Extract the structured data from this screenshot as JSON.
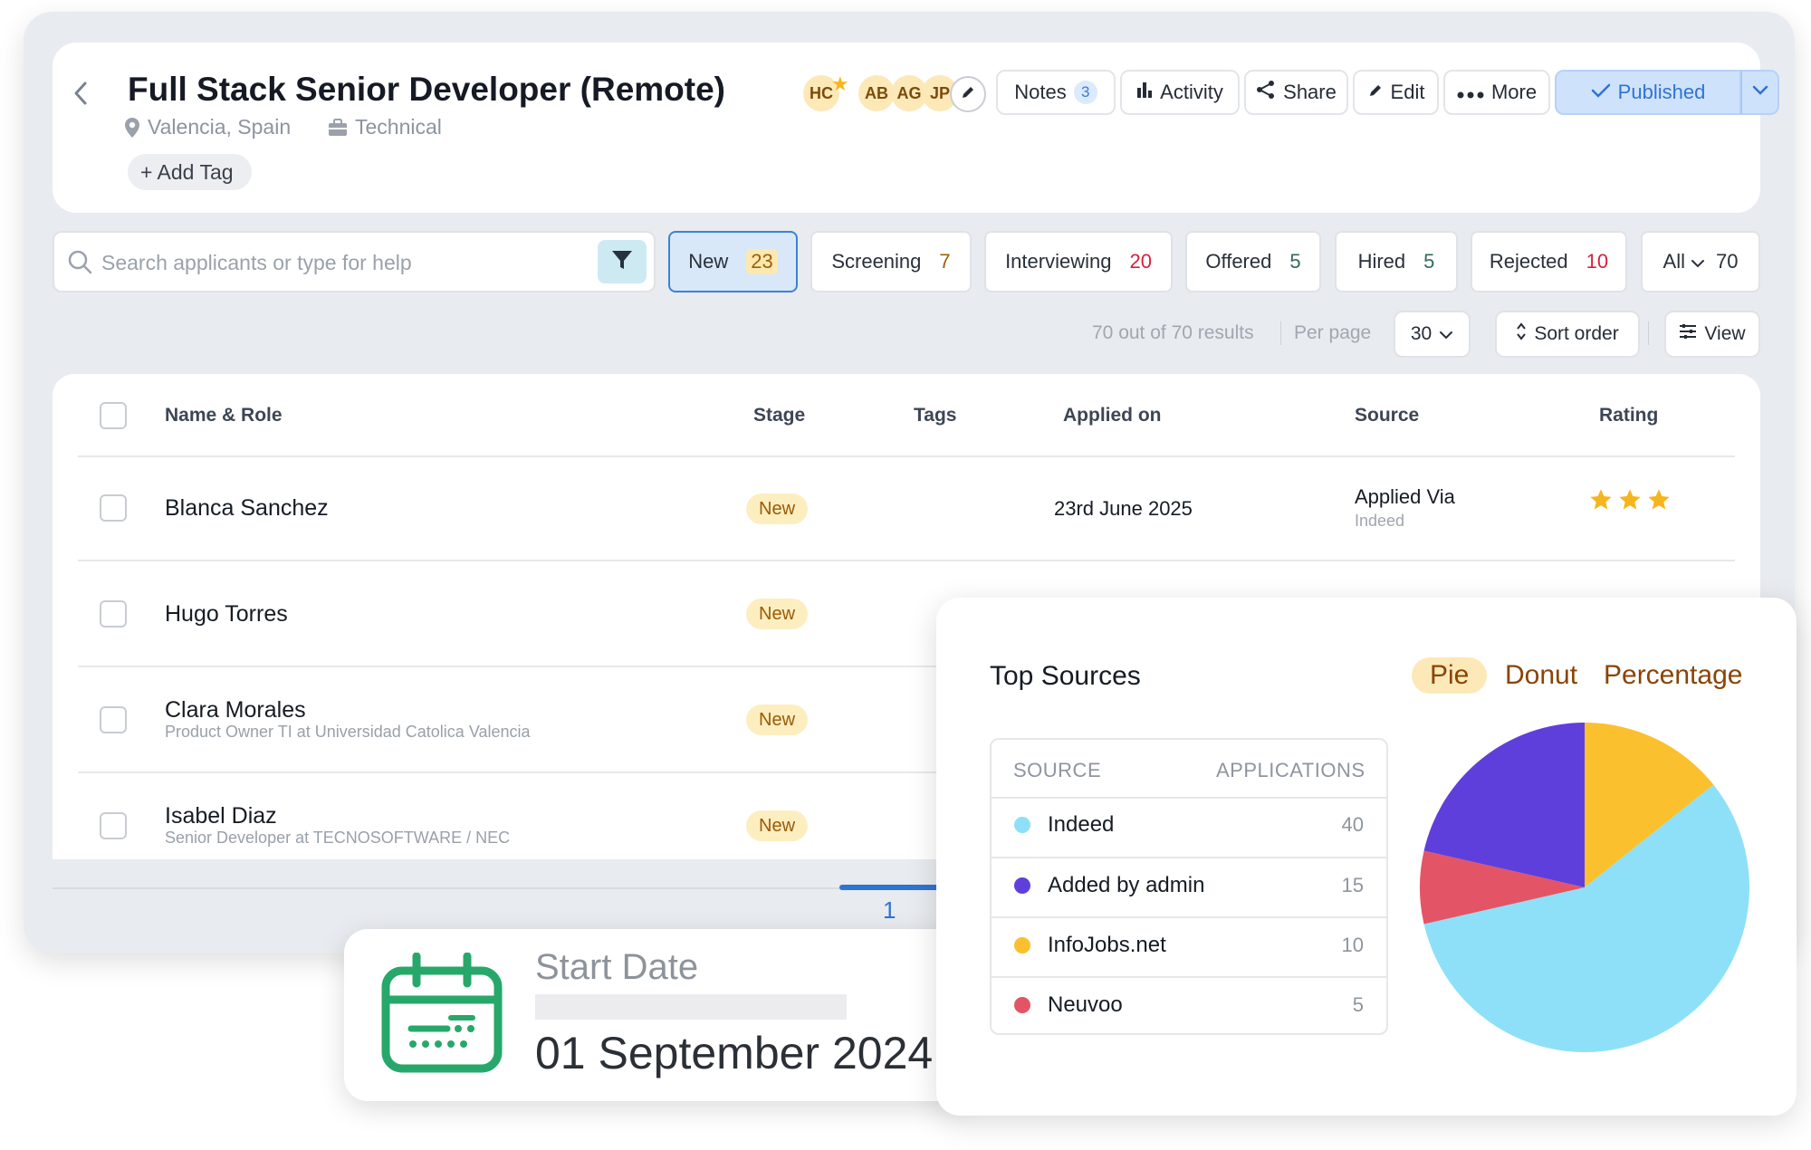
{
  "header": {
    "back_icon": "chevron-left-icon",
    "title": "Full Stack Senior Developer (Remote)",
    "location": "Valencia, Spain",
    "department": "Technical",
    "add_tag_label": "+ Add Tag",
    "avatars": [
      "HC",
      "AB",
      "AG",
      "JP"
    ],
    "buttons": {
      "notes_label": "Notes",
      "notes_count": "3",
      "activity_label": "Activity",
      "share_label": "Share",
      "edit_label": "Edit",
      "more_label": "More",
      "published_label": "Published"
    }
  },
  "search": {
    "placeholder": "Search applicants or type for help"
  },
  "stages": [
    {
      "label": "New",
      "count": "23",
      "count_color": "#9c5f05"
    },
    {
      "label": "Screening",
      "count": "7",
      "count_color": "#9c5f05"
    },
    {
      "label": "Interviewing",
      "count": "20",
      "count_color": "#d8203a"
    },
    {
      "label": "Offered",
      "count": "5",
      "count_color": "#2f6b5e"
    },
    {
      "label": "Hired",
      "count": "5",
      "count_color": "#2f6b5e"
    },
    {
      "label": "Rejected",
      "count": "10",
      "count_color": "#d8203a"
    },
    {
      "label": "All",
      "count": "70",
      "count_color": "#2a303a"
    }
  ],
  "list_controls": {
    "results_text": "70 out of 70 results",
    "per_page_label": "Per page",
    "per_page_value": "30",
    "sort_label": "Sort order",
    "view_label": "View"
  },
  "table": {
    "columns": [
      "Name & Role",
      "Stage",
      "Tags",
      "Applied on",
      "Source",
      "Rating"
    ],
    "rows": [
      {
        "name": "Blanca Sanchez",
        "role": "",
        "stage": "New",
        "applied_on": "23rd June 2025",
        "source": "Applied Via",
        "source_detail": "Indeed",
        "rating": 3
      },
      {
        "name": "Hugo Torres",
        "role": "",
        "stage": "New"
      },
      {
        "name": "Clara Morales",
        "role": "Product Owner TI at Universidad Catolica Valencia",
        "stage": "New"
      },
      {
        "name": "Isabel Diaz",
        "role": "Senior Developer at TECNOSOFTWARE / NEC",
        "stage": "New"
      }
    ]
  },
  "pagination": {
    "current_page": "1"
  },
  "start_date": {
    "label": "Start Date",
    "value": "01 September 2024",
    "icon": "calendar-icon",
    "icon_color": "#27a86a"
  },
  "top_sources": {
    "title": "Top Sources",
    "view_tabs": [
      "Pie",
      "Donut",
      "Percentage"
    ],
    "active_view": "Pie",
    "table_headers": [
      "SOURCE",
      "APPLICATIONS"
    ],
    "chart_data": {
      "type": "pie",
      "categories": [
        "Indeed",
        "Added by admin",
        "InfoJobs.net",
        "Neuvoo"
      ],
      "values": [
        40,
        15,
        10,
        5
      ],
      "colors": [
        "#8ee0f8",
        "#5f3fdc",
        "#fbc02d",
        "#e35566"
      ]
    }
  }
}
